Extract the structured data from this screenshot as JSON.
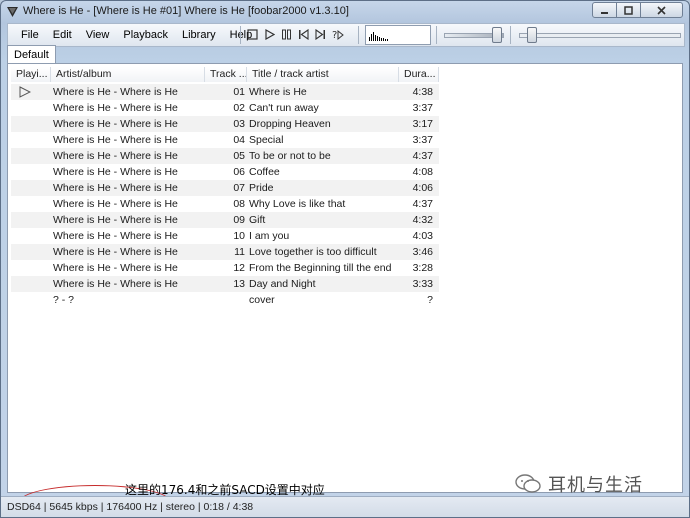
{
  "window": {
    "title": "Where is He - [Where is He #01] Where is He  [foobar2000 v1.3.10]"
  },
  "menu": [
    "File",
    "Edit",
    "View",
    "Playback",
    "Library",
    "Help"
  ],
  "toolbar": {
    "buttons": [
      "stop-icon",
      "play-icon",
      "pause-icon",
      "previous-icon",
      "next-icon",
      "random-icon"
    ]
  },
  "tabs": [
    {
      "label": "Default",
      "selected": true
    }
  ],
  "playlist": {
    "columns": [
      "Playi...",
      "Artist/album",
      "Track ...",
      "Title / track artist",
      "Dura..."
    ],
    "now_playing_index": 0,
    "rows": [
      {
        "artist_album": "Where is He - Where is He",
        "track": "01",
        "title": "Where is He",
        "duration": "4:38"
      },
      {
        "artist_album": "Where is He - Where is He",
        "track": "02",
        "title": "Can't run away",
        "duration": "3:37"
      },
      {
        "artist_album": "Where is He - Where is He",
        "track": "03",
        "title": "Dropping Heaven",
        "duration": "3:17"
      },
      {
        "artist_album": "Where is He - Where is He",
        "track": "04",
        "title": "Special",
        "duration": "3:37"
      },
      {
        "artist_album": "Where is He - Where is He",
        "track": "05",
        "title": "To be or not to be",
        "duration": "4:37"
      },
      {
        "artist_album": "Where is He - Where is He",
        "track": "06",
        "title": "Coffee",
        "duration": "4:08"
      },
      {
        "artist_album": "Where is He - Where is He",
        "track": "07",
        "title": "Pride",
        "duration": "4:06"
      },
      {
        "artist_album": "Where is He - Where is He",
        "track": "08",
        "title": "Why Love is like that",
        "duration": "4:37"
      },
      {
        "artist_album": "Where is He - Where is He",
        "track": "09",
        "title": "Gift",
        "duration": "4:32"
      },
      {
        "artist_album": "Where is He - Where is He",
        "track": "10",
        "title": "I am you",
        "duration": "4:03"
      },
      {
        "artist_album": "Where is He - Where is He",
        "track": "11",
        "title": "Love together is too difficult",
        "duration": "3:46"
      },
      {
        "artist_album": "Where is He - Where is He",
        "track": "12",
        "title": "From the Beginning till the end",
        "duration": "3:28"
      },
      {
        "artist_album": "Where is He - Where is He",
        "track": "13",
        "title": "Day and Night",
        "duration": "3:33"
      },
      {
        "artist_album": "? - ?",
        "track": "",
        "title": "cover",
        "duration": "?"
      }
    ]
  },
  "status": "DSD64 | 5645 kbps | 176400 Hz | stereo | 0:18 / 4:38",
  "annotation": {
    "caption": "这里的176.4和之前SACD设置中对应",
    "brand": "耳机与生活",
    "highlight_color": "#c62b2b"
  }
}
